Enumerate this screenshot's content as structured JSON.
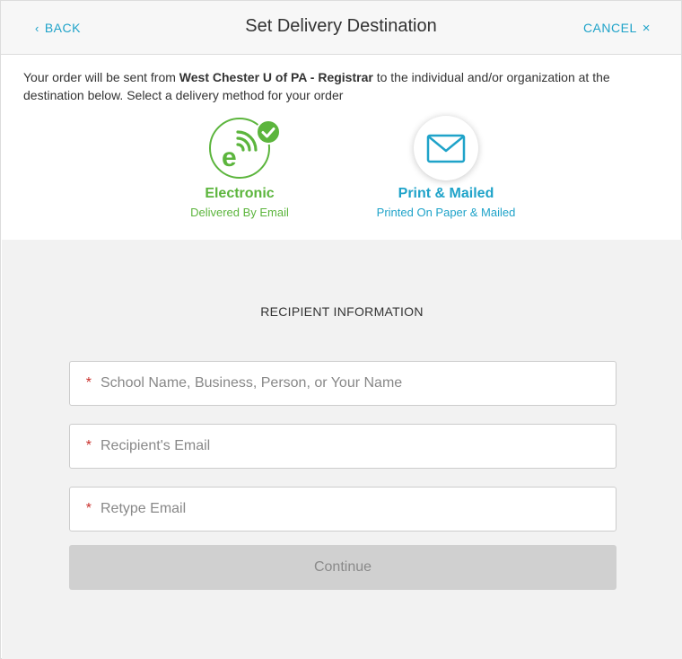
{
  "header": {
    "back_label": "BACK",
    "title": "Set Delivery Destination",
    "cancel_label": "CANCEL"
  },
  "intro": {
    "prefix": "Your order will be sent from ",
    "sender": "West Chester U of PA - Registrar",
    "suffix": " to the individual and/or organization at the destination below. Select a delivery method for your order"
  },
  "delivery_options": [
    {
      "title": "Electronic",
      "subtitle": "Delivered By Email",
      "icon": "electronic-e-icon",
      "selected": true
    },
    {
      "title": "Print & Mailed",
      "subtitle": "Printed On Paper & Mailed",
      "icon": "envelope-icon",
      "selected": false
    }
  ],
  "form": {
    "section_title": "RECIPIENT INFORMATION",
    "required_mark": "*",
    "fields": [
      {
        "placeholder": "School Name, Business, Person, or Your Name",
        "value": ""
      },
      {
        "placeholder": "Recipient's Email",
        "value": ""
      },
      {
        "placeholder": "Retype Email",
        "value": ""
      }
    ],
    "continue_label": "Continue"
  },
  "colors": {
    "accent_blue": "#1fa3c9",
    "accent_green": "#5cb53d",
    "required_red": "#c9302c",
    "disabled_button": "#d0d0d0"
  }
}
